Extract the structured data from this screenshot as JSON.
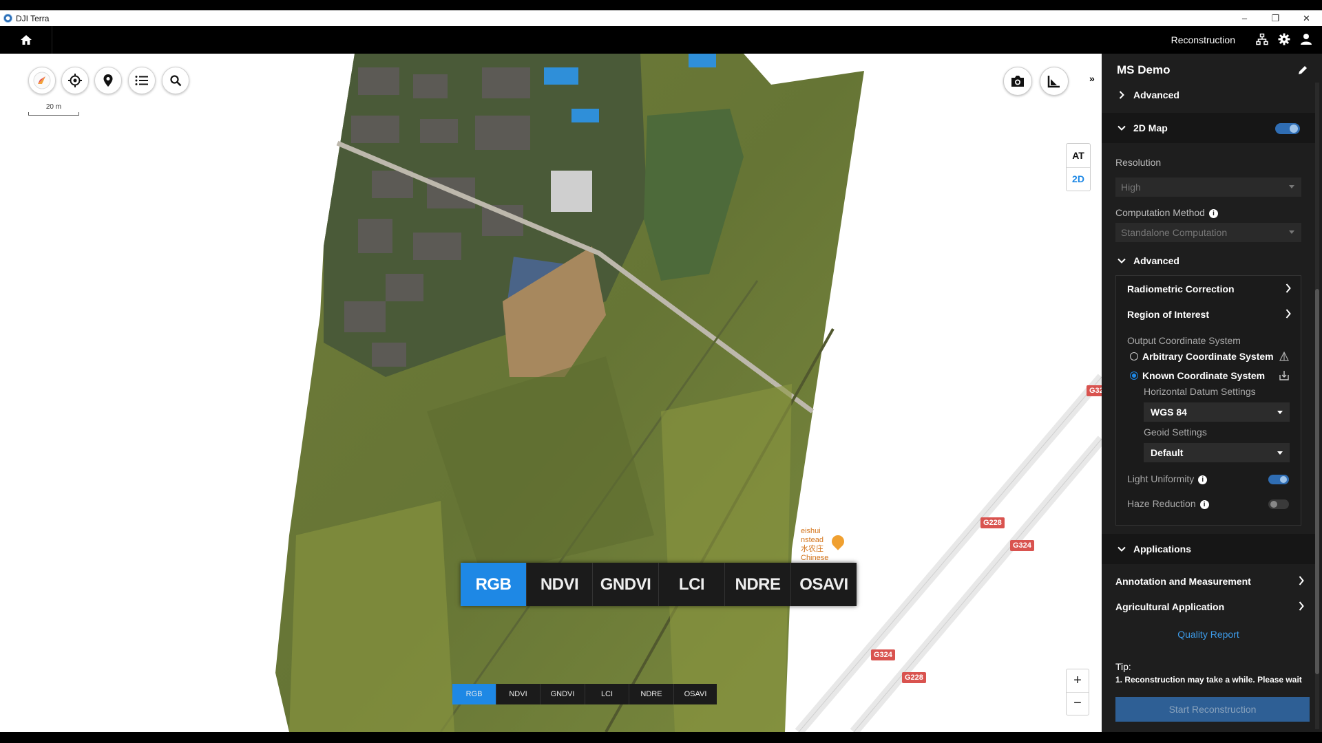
{
  "window": {
    "title": "DJI Terra",
    "minimize": "–",
    "restore": "❐",
    "close": "✕"
  },
  "header": {
    "mode": "Reconstruction"
  },
  "map": {
    "scale_label": "20 m",
    "view_modes": [
      "AT",
      "2D"
    ],
    "zoom_in": "+",
    "zoom_out": "−",
    "collapse": "»",
    "index_tabs": [
      "RGB",
      "NDVI",
      "GNDVI",
      "LCI",
      "NDRE",
      "OSAVI"
    ],
    "index_tabs_small": [
      "RGB",
      "NDVI",
      "GNDVI",
      "LCI",
      "NDRE",
      "OSAVI"
    ],
    "active_index": "RGB",
    "road_labels": [
      "G32",
      "G228",
      "G324",
      "G324",
      "G228"
    ],
    "poi": {
      "line1": "eishui",
      "line2": "nstead",
      "line3": "水农庄",
      "line4": "Chinese"
    }
  },
  "panel": {
    "title": "MS Demo",
    "advanced_top": "Advanced",
    "map2d": {
      "label": "2D Map",
      "enabled": true
    },
    "resolution": {
      "label": "Resolution",
      "value": "High"
    },
    "computation": {
      "label": "Computation Method",
      "value": "Standalone Computation"
    },
    "advanced": {
      "label": "Advanced",
      "radiometric": "Radiometric Correction",
      "roi": "Region of Interest",
      "output_cs_label": "Output Coordinate System",
      "arbitrary_cs": "Arbitrary Coordinate System",
      "known_cs": "Known Coordinate System",
      "known_cs_selected": true,
      "horizontal_label": "Horizontal Datum Settings",
      "horizontal_value": "WGS 84",
      "geoid_label": "Geoid Settings",
      "geoid_value": "Default",
      "light_uniformity": {
        "label": "Light Uniformity",
        "enabled": true
      },
      "haze_reduction": {
        "label": "Haze Reduction",
        "enabled": false
      }
    },
    "applications": {
      "label": "Applications",
      "items": [
        "Annotation and Measurement",
        "Agricultural Application"
      ]
    },
    "quality_report": "Quality Report",
    "tip": {
      "title": "Tip:",
      "text": "1. Reconstruction may take a while. Please wait"
    },
    "start_button": "Start Reconstruction"
  },
  "colors": {
    "accent": "#1e88e5",
    "panel_bg": "#1e1e1e",
    "road_label": "#d9534f"
  }
}
